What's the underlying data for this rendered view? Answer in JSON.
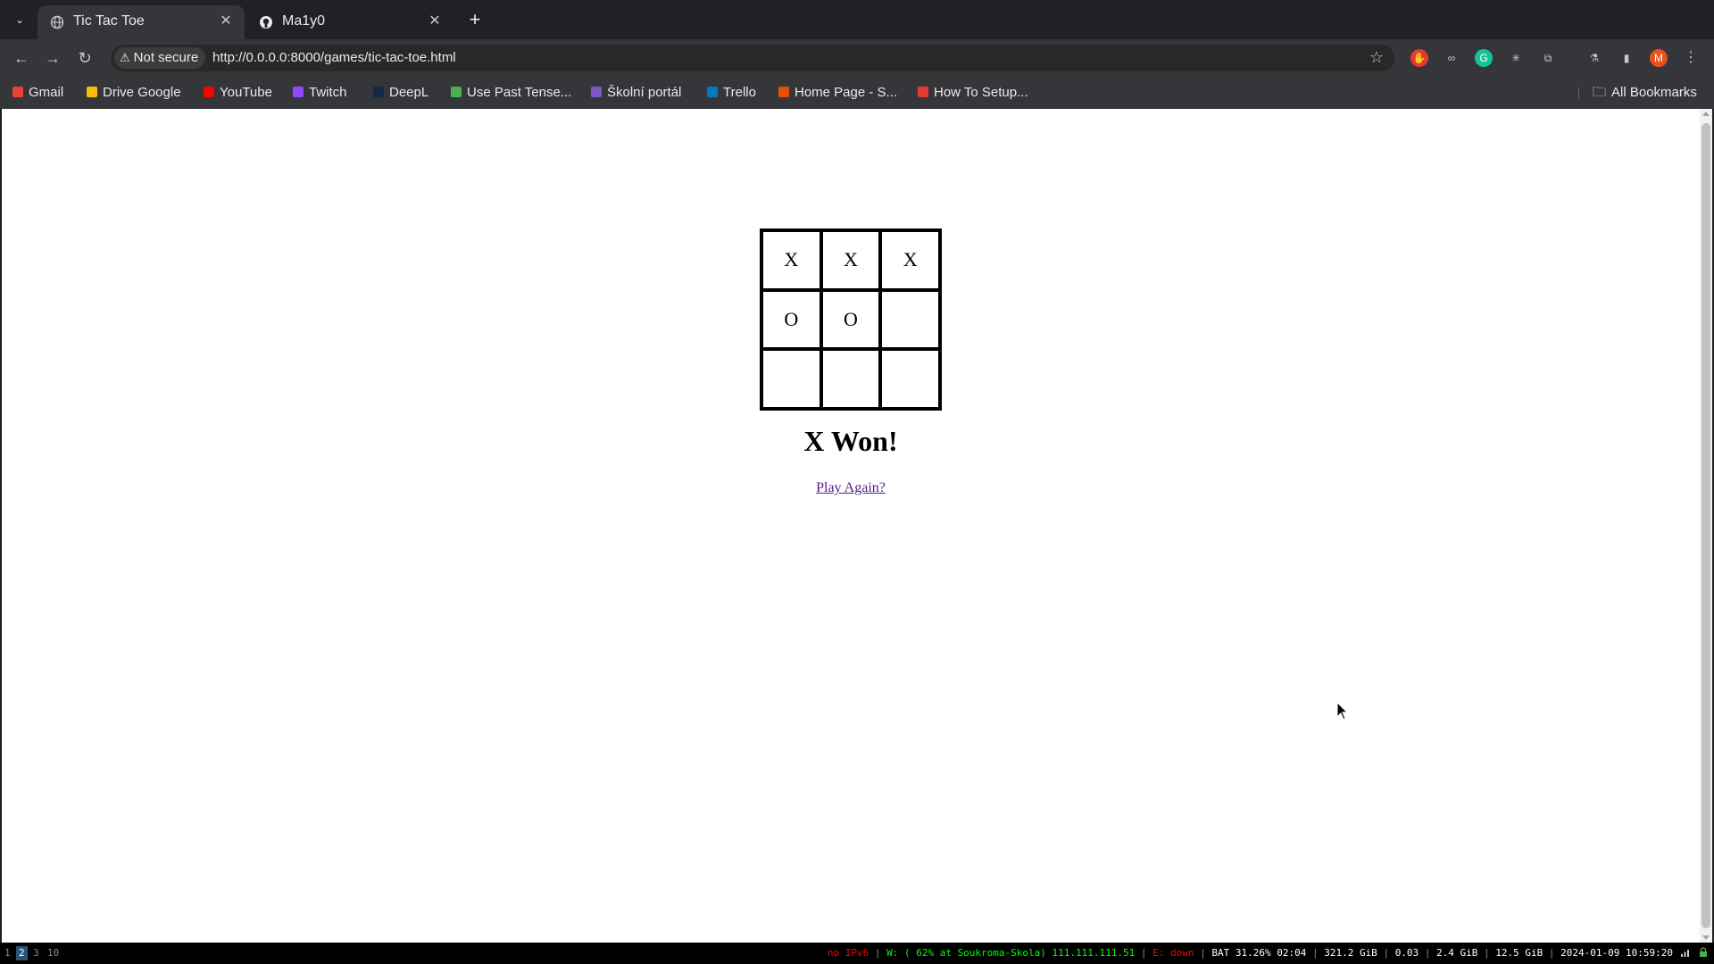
{
  "tabs": [
    {
      "label": "Tic Tac Toe",
      "icon": "globe-icon",
      "active": true
    },
    {
      "label": "Ma1y0",
      "icon": "github-icon",
      "active": false
    }
  ],
  "address": {
    "security_label": "Not secure",
    "url": "http://0.0.0.0:8000/games/tic-tac-toe.html"
  },
  "bookmarks": [
    {
      "label": "Gmail",
      "icon": "gmail-icon",
      "color": "#ea4335"
    },
    {
      "label": "Drive Google",
      "icon": "drive-icon",
      "color": "#fbbc04"
    },
    {
      "label": "YouTube",
      "icon": "youtube-icon",
      "color": "#ff0000"
    },
    {
      "label": "Twitch",
      "icon": "twitch-icon",
      "color": "#9146ff"
    },
    {
      "label": "DeepL",
      "icon": "deepl-icon",
      "color": "#0f2b46"
    },
    {
      "label": "Use Past Tense...",
      "icon": "page-icon",
      "color": "#4caf50"
    },
    {
      "label": "Školní portál",
      "icon": "school-icon",
      "color": "#7e57c2"
    },
    {
      "label": "Trello",
      "icon": "trello-icon",
      "color": "#0079bf"
    },
    {
      "label": "Home Page - S...",
      "icon": "home-icon",
      "color": "#e65100"
    },
    {
      "label": "How To Setup...",
      "icon": "setup-icon",
      "color": "#e53935"
    }
  ],
  "all_bookmarks_label": "All Bookmarks",
  "game": {
    "board": [
      "X",
      "X",
      "X",
      "O",
      "O",
      "",
      "",
      "",
      ""
    ],
    "result": "X Won!",
    "play_again": "Play Again?"
  },
  "statusbar": {
    "workspaces": [
      "1",
      "2",
      "3",
      "10"
    ],
    "active_workspace": "2",
    "ipv6": "no IPv6",
    "wifi": "W: ( 62% at Soukroma-Skola) 111.111.111.51",
    "ethernet": "E: down",
    "battery": "BAT 31.26% 02:04",
    "disk": "321.2 GiB",
    "load": "0.03",
    "memory": "2.4 GiB",
    "swap": "12.5 GiB",
    "datetime": "2024-01-09 10:59:20"
  },
  "colors": {
    "link_visited": "#551a8b",
    "status_red": "#ff0000",
    "status_green": "#00ff00"
  }
}
